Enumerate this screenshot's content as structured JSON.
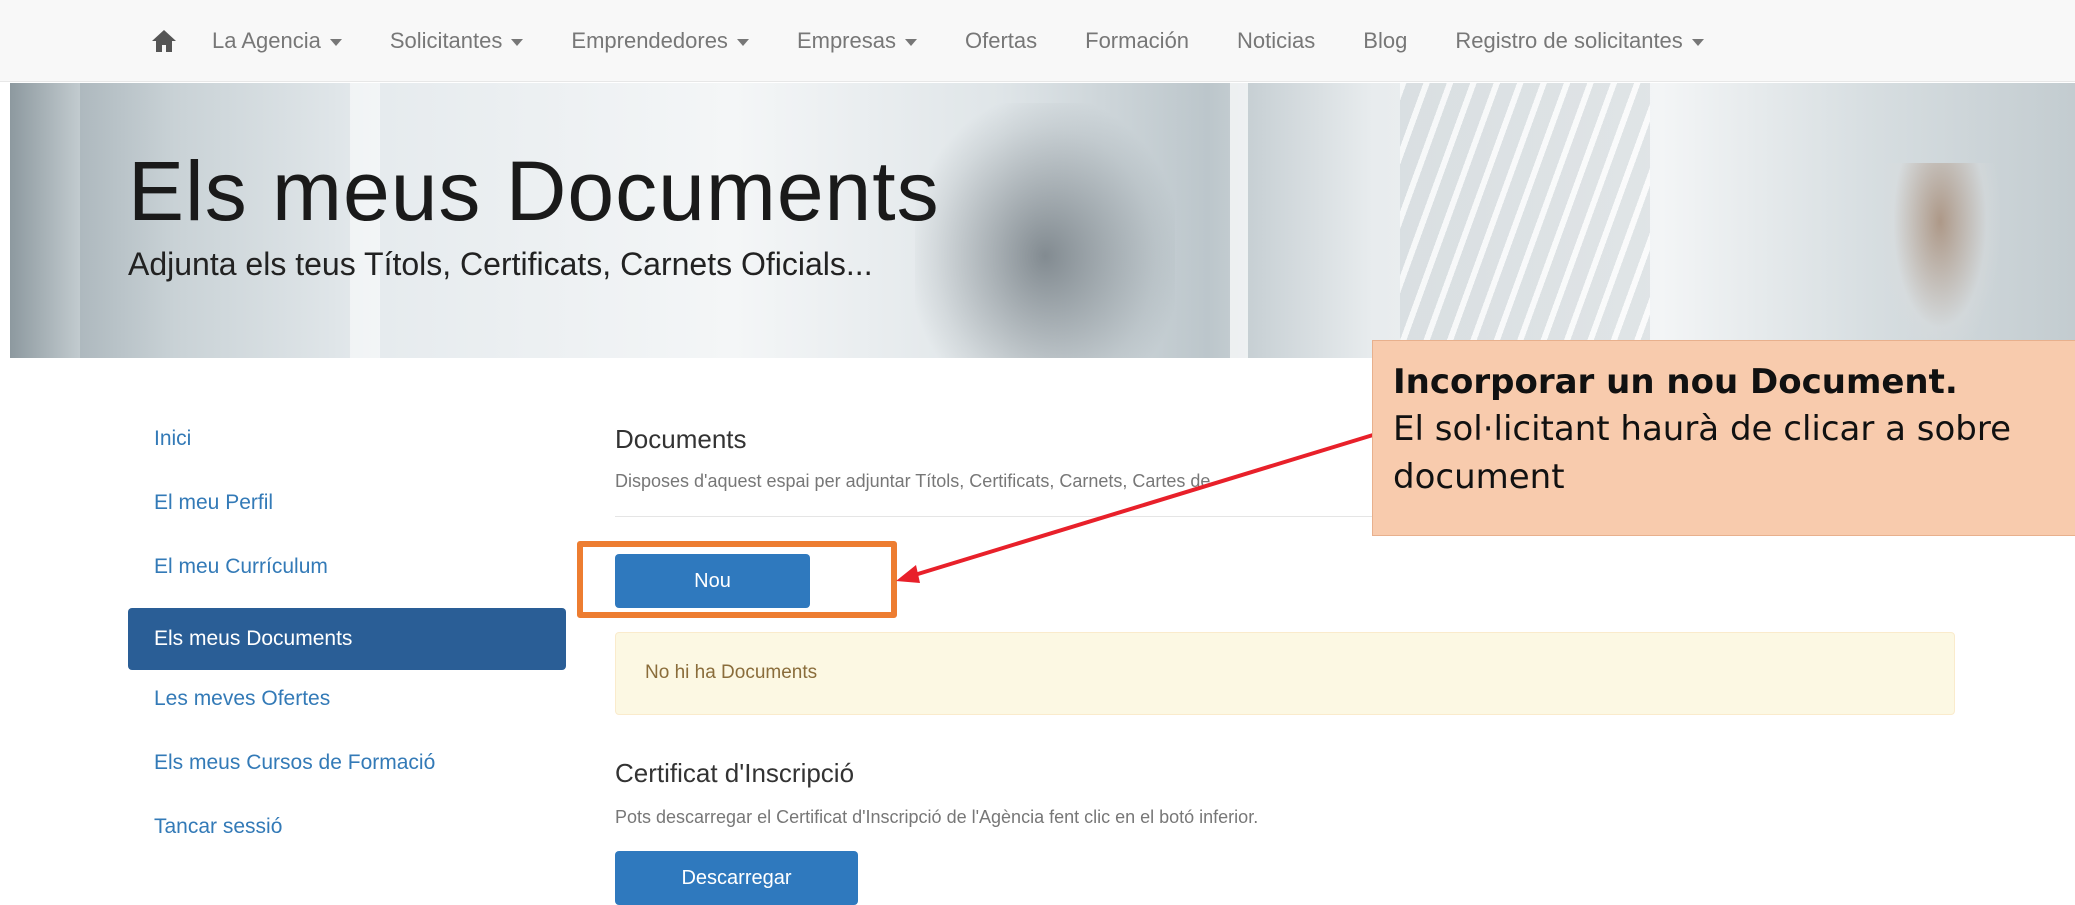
{
  "nav": {
    "items": [
      {
        "label": "La Agencia",
        "dropdown": true
      },
      {
        "label": "Solicitantes",
        "dropdown": true
      },
      {
        "label": "Emprendedores",
        "dropdown": true
      },
      {
        "label": "Empresas",
        "dropdown": true
      },
      {
        "label": "Ofertas",
        "dropdown": false
      },
      {
        "label": "Formación",
        "dropdown": false
      },
      {
        "label": "Noticias",
        "dropdown": false
      },
      {
        "label": "Blog",
        "dropdown": false
      },
      {
        "label": "Registro de solicitantes",
        "dropdown": true
      }
    ],
    "home_icon": "home-icon"
  },
  "hero": {
    "title": "Els meus Documents",
    "subtitle": "Adjunta els teus Títols, Certificats, Carnets Oficials..."
  },
  "sidebar": {
    "items": [
      {
        "label": "Inici",
        "active": false
      },
      {
        "label": "El meu Perfil",
        "active": false
      },
      {
        "label": "El meu Currículum",
        "active": false
      },
      {
        "label": "Els meus Documents",
        "active": true
      },
      {
        "label": "Les meves Ofertes",
        "active": false
      },
      {
        "label": "Els meus Cursos de Formació",
        "active": false
      },
      {
        "label": "Tancar sessió",
        "active": false
      }
    ]
  },
  "documents": {
    "title": "Documents",
    "description": "Disposes d'aquest espai per adjuntar Títols, Certificats, Carnets, Cartes de",
    "new_button": "Nou",
    "empty_message": "No hi ha Documents"
  },
  "certificate": {
    "title": "Certificat d'Inscripció",
    "description": "Pots descarregar el Certificat d'Inscripció de l'Agència fent clic en el botó inferior.",
    "download_button": "Descarregar"
  },
  "callout": {
    "title": "Incorporar un nou Document.",
    "line1": "El sol·licitant haurà de clicar a sobre",
    "line2": "document"
  },
  "colors": {
    "primary_button": "#2f79be",
    "active_sidebar": "#2a5e96",
    "callout_bg": "#f8cbad",
    "highlight_border": "#ed7d31",
    "arrow": "#e8202a"
  }
}
